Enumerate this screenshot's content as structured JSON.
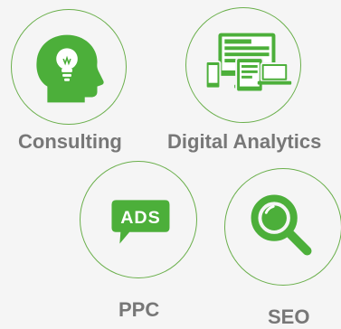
{
  "services": [
    {
      "label": "Consulting",
      "icon": "head-lightbulb-icon"
    },
    {
      "label": "Digital Analytics",
      "icon": "devices-icon"
    },
    {
      "label": "PPC",
      "icon": "ads-speech-bubble-icon",
      "icon_text": "ADS"
    },
    {
      "label": "SEO",
      "icon": "magnifying-glass-icon"
    }
  ],
  "colors": {
    "accent": "#4caf3a",
    "accent_dark": "#3e9a2e",
    "circle_border": "#6aaf4b",
    "label": "#777777",
    "background": "#f5f5f5"
  }
}
